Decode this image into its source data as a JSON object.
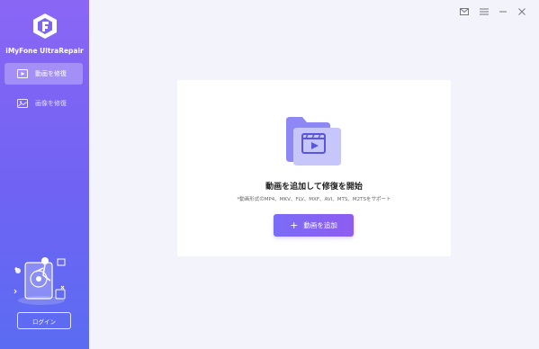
{
  "sidebar": {
    "app_name": "iMyFone UltraRepair",
    "items": [
      {
        "label": "動画を修復",
        "icon": "video-play-icon",
        "active": true
      },
      {
        "label": "画像を修復",
        "icon": "image-icon",
        "active": false
      }
    ],
    "login_label": "ログイン"
  },
  "window_controls": [
    "mail-icon",
    "menu-icon",
    "minimize-icon",
    "close-icon"
  ],
  "main": {
    "title": "動画を追加して修復を開始",
    "subtitle": "*動画形式のMP4、MKV、FLV、MXF、AVI、MTS、M2TSをサポート",
    "add_button_label": "動画を追加",
    "add_button_icon": "plus-icon"
  },
  "colors": {
    "sidebar_top": "#8b66f5",
    "sidebar_bottom": "#5b6cf2",
    "accent": "#7b6cf6",
    "background": "#f3f3fb"
  }
}
